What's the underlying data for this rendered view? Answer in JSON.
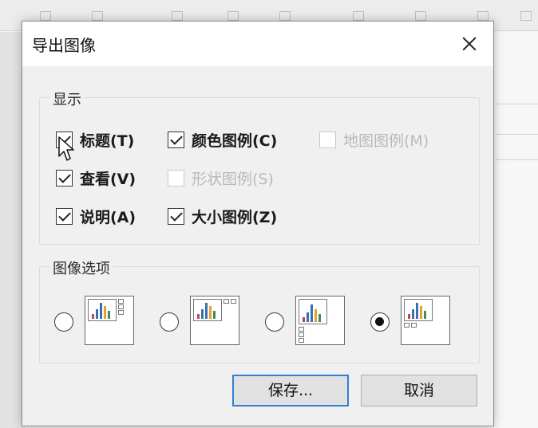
{
  "dialog": {
    "title": "导出图像",
    "close_icon": "close-icon"
  },
  "display_group": {
    "label": "显示",
    "options": [
      {
        "label": "标题(T)",
        "checked": true,
        "enabled": true
      },
      {
        "label": "颜色图例(C)",
        "checked": true,
        "enabled": true
      },
      {
        "label": "地图图例(M)",
        "checked": false,
        "enabled": false
      },
      {
        "label": "查看(V)",
        "checked": true,
        "enabled": true
      },
      {
        "label": "形状图例(S)",
        "checked": false,
        "enabled": false
      },
      {
        "label": "说明(A)",
        "checked": true,
        "enabled": true
      },
      {
        "label": "大小图例(Z)",
        "checked": true,
        "enabled": true
      }
    ]
  },
  "image_options": {
    "label": "图像选项",
    "layouts": [
      {
        "name": "legend-right",
        "selected": false
      },
      {
        "name": "legend-top-right",
        "selected": false
      },
      {
        "name": "legend-bottom-left",
        "selected": false
      },
      {
        "name": "legend-below",
        "selected": true
      }
    ]
  },
  "buttons": {
    "save": "保存...",
    "cancel": "取消"
  },
  "colors": {
    "primary_border": "#2f7fd3",
    "bar_blue": "#3a6fb3",
    "bar_orange": "#e8a02a",
    "bar_green": "#3f8f4f",
    "bar_red": "#b84a4a"
  }
}
